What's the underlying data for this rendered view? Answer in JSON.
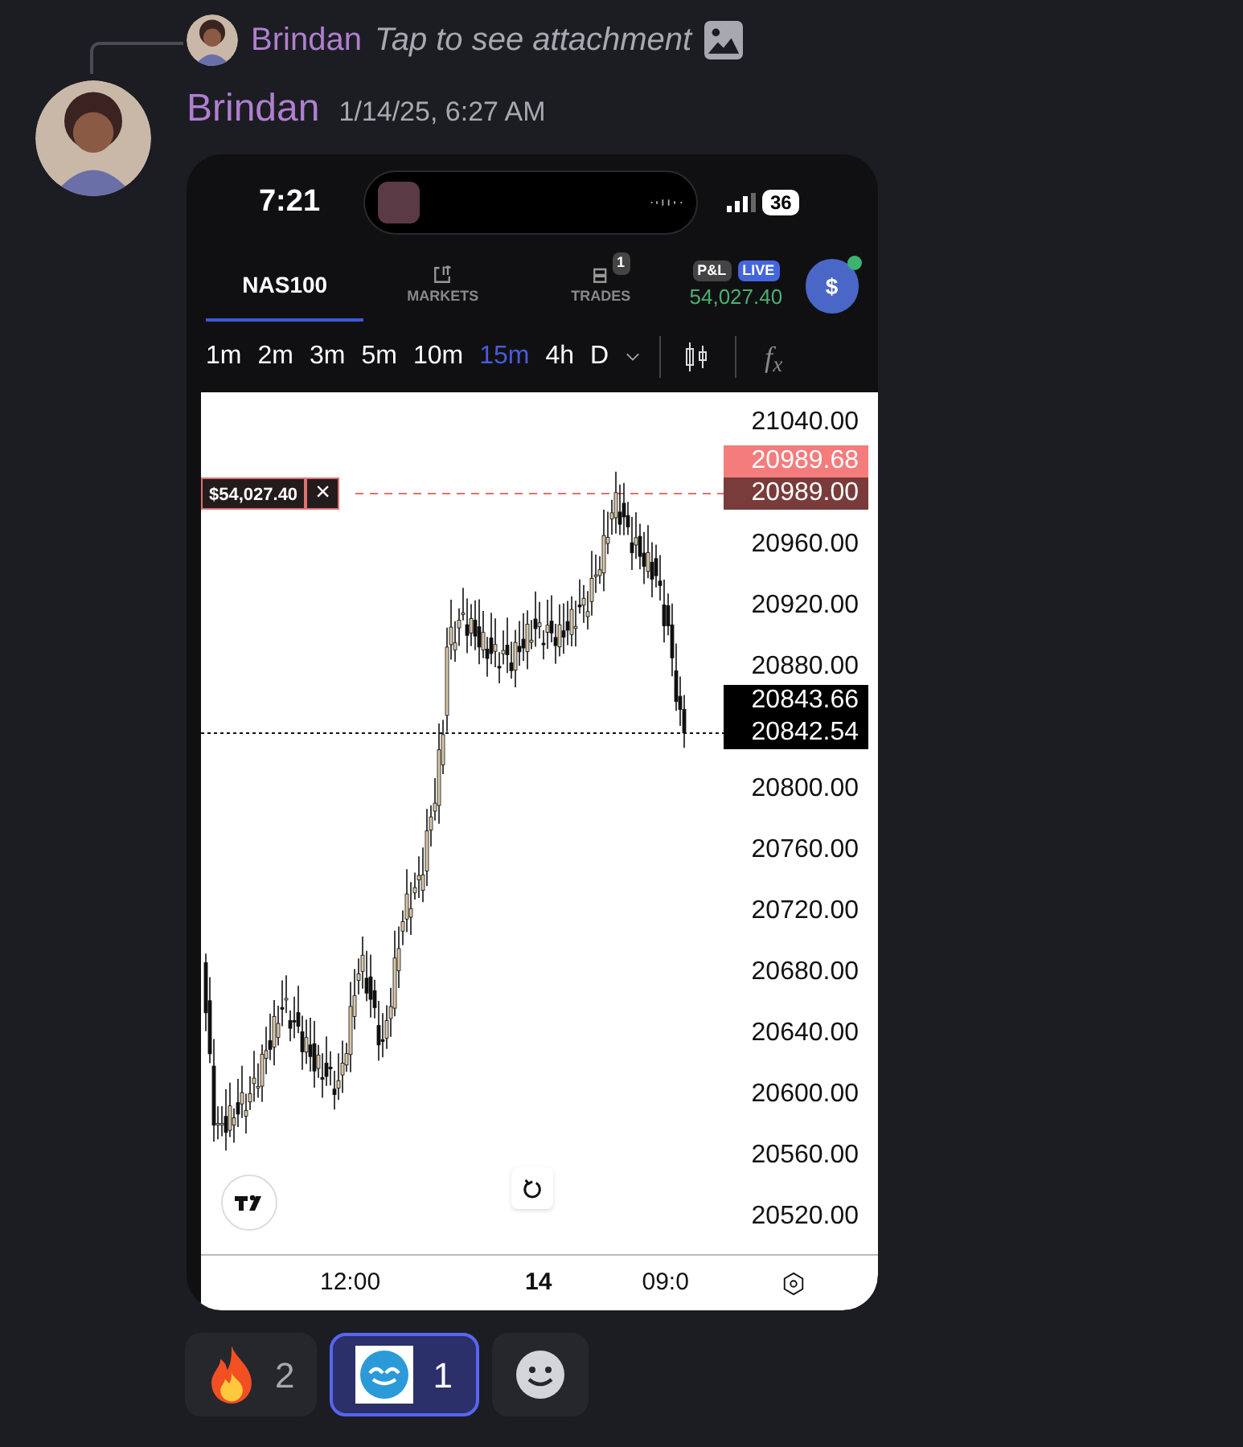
{
  "reply": {
    "author": "Brindan",
    "text": "Tap to see attachment"
  },
  "message": {
    "author": "Brindan",
    "timestamp": "1/14/25, 6:27 AM"
  },
  "phone": {
    "time": "7:21",
    "battery": "36",
    "tabs": [
      {
        "label": "NAS100",
        "selected": true,
        "kind": "symbol"
      },
      {
        "label": "MARKETS",
        "selected": false,
        "kind": "markets"
      },
      {
        "label": "TRADES",
        "selected": false,
        "kind": "trades",
        "badge": "1"
      }
    ],
    "pnl": {
      "label": "P&L",
      "live": "LIVE",
      "value": "54,027.40"
    },
    "account_button": "$",
    "timeframes": [
      {
        "label": "1m",
        "selected": false
      },
      {
        "label": "2m",
        "selected": false
      },
      {
        "label": "3m",
        "selected": false
      },
      {
        "label": "5m",
        "selected": false
      },
      {
        "label": "10m",
        "selected": false
      },
      {
        "label": "15m",
        "selected": true
      },
      {
        "label": "4h",
        "selected": false
      },
      {
        "label": "D",
        "selected": false
      }
    ],
    "function_button": "f$_{x}$",
    "chart": {
      "price_labels": [
        "21040.00",
        "20960.00",
        "20920.00",
        "20880.00",
        "20800.00",
        "20760.00",
        "20720.00",
        "20680.00",
        "20640.00",
        "20600.00",
        "20560.00",
        "20520.00"
      ],
      "order_tag": "$54,027.40",
      "order_close": "×",
      "price_tags": [
        {
          "text": "20989.68",
          "kind": "ask"
        },
        {
          "text": "20989.00",
          "kind": "order"
        },
        {
          "text": "20843.66",
          "kind": "bid"
        },
        {
          "text": "20842.54",
          "kind": "last"
        }
      ],
      "time_labels": [
        {
          "text": "12:00",
          "bold": false
        },
        {
          "text": "14",
          "bold": true
        },
        {
          "text": "09:0",
          "bold": false
        }
      ]
    }
  },
  "reactions": [
    {
      "kind": "fire",
      "count": "2",
      "selected": false
    },
    {
      "kind": "custom",
      "count": "1",
      "selected": true
    }
  ]
}
